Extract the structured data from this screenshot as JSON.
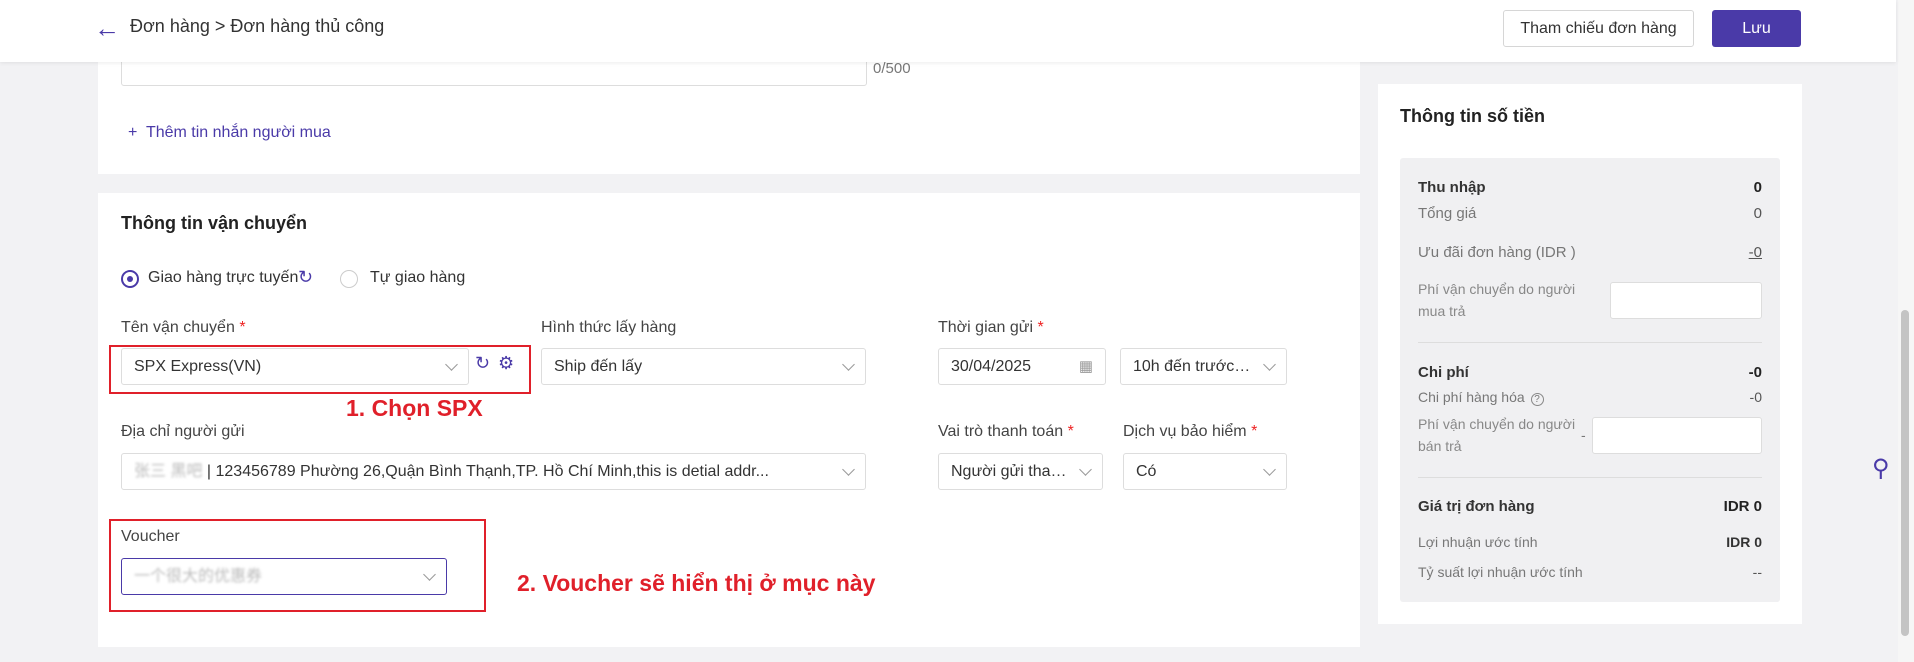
{
  "header": {
    "breadcrumb": "Đơn hàng > Đơn hàng thủ công",
    "ref_button": "Tham chiếu đơn hàng",
    "save_button": "Lưu"
  },
  "message_section": {
    "counter": "0/500",
    "add_message": "Thêm tin nhắn người mua"
  },
  "shipping": {
    "title": "Thông tin vận chuyển",
    "option_online": "Giao hàng trực tuyến",
    "option_self": "Tự giao hàng",
    "carrier_label": "Tên vận chuyển",
    "carrier_value": "SPX Express(VN)",
    "pickup_label": "Hình thức lấy hàng",
    "pickup_value": "Ship đến lấy",
    "send_time_label": "Thời gian gửi",
    "send_date": "30/04/2025",
    "send_slot": "10h đến trước 1...",
    "sender_address_label": "Địa chỉ người gửi",
    "sender_address_name": "张三 黑吧",
    "sender_address_value": "| 123456789 Phường 26,Quận Bình Thạnh,TP. Hồ Chí Minh,this is detial addr...",
    "payment_role_label": "Vai trò thanh toán",
    "payment_role_value": "Người gửi than...",
    "insurance_label": "Dịch vụ bảo hiểm",
    "insurance_value": "Có",
    "voucher_label": "Voucher",
    "voucher_value": "一个很大的优惠券",
    "required_mark": "*"
  },
  "annotations": {
    "step1": "1. Chọn SPX",
    "step2": "2. Voucher sẽ hiển thị ở mục này"
  },
  "money": {
    "title": "Thông tin số tiền",
    "income_label": "Thu nhập",
    "income_value": "0",
    "total_label": "Tổng giá",
    "total_value": "0",
    "discount_label": "Ưu đãi đơn hàng (IDR )",
    "discount_value": "-0",
    "buyer_ship_label": "Phí vận chuyển do người mua trả",
    "cost_label": "Chi phí",
    "cost_value": "-0",
    "goods_cost_label": "Chi phí hàng hóa",
    "goods_cost_value": "-0",
    "seller_ship_label": "Phí vận chuyển do người bán trả",
    "seller_ship_prefix": "-",
    "order_value_label": "Giá trị đơn hàng",
    "order_value": "IDR 0",
    "profit_label": "Lợi nhuận ước tính",
    "profit_value": "IDR 0",
    "margin_label": "Tỷ suất lợi nhuận ước tính",
    "margin_value": "--"
  },
  "colors": {
    "accent": "#4a3aa8",
    "annotation": "#e0202a"
  }
}
